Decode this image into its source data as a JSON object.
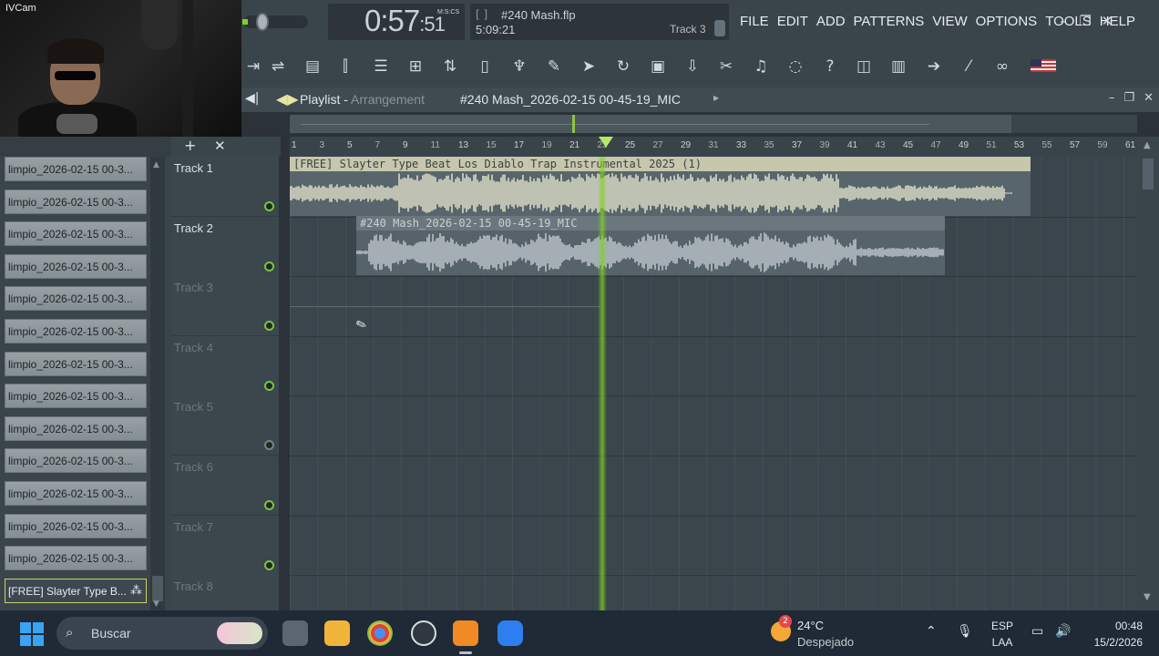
{
  "webcam": {
    "label": "IVCam"
  },
  "transport": {
    "time_main": "0:57",
    "time_sub": ":51",
    "time_format": "M:S:CS"
  },
  "song": {
    "brackets": "[ ]",
    "filename": "#240 Mash.flp",
    "length": "5:09:21",
    "track": "Track 3"
  },
  "menu": [
    "FILE",
    "EDIT",
    "ADD",
    "PATTERNS",
    "VIEW",
    "OPTIONS",
    "TOOLS",
    "HELP"
  ],
  "window_controls": [
    "minimize-icon",
    "restore-icon",
    "close-icon"
  ],
  "toolbar_icons": [
    "tempo-icon",
    "pattern-mode-icon",
    "piano-roll-icon",
    "mixer-icon",
    "channel-rack-icon",
    "step-seq-icon",
    "split-icon",
    "new-file-icon",
    "plugin-icon",
    "brush-icon",
    "pointer-icon",
    "undo-icon",
    "save-icon",
    "render-icon",
    "cut-icon",
    "microphone-icon",
    "chat-icon",
    "help-icon",
    "window-icon",
    "keyboard-icon",
    "arrow-icon",
    "pencil-icon",
    "link-icon",
    "us-flag-icon"
  ],
  "playlist": {
    "title": "Playlist",
    "mode": "Arrangement",
    "pattern": "#240 Mash_2026-02-15 00-45-19_MIC"
  },
  "browser": {
    "items": [
      "limpio_2026-02-15 00-3...",
      "limpio_2026-02-15 00-3...",
      "limpio_2026-02-15 00-3...",
      "limpio_2026-02-15 00-3...",
      "limpio_2026-02-15 00-3...",
      "limpio_2026-02-15 00-3...",
      "limpio_2026-02-15 00-3...",
      "limpio_2026-02-15 00-3...",
      "limpio_2026-02-15 00-3...",
      "limpio_2026-02-15 00-3...",
      "limpio_2026-02-15 00-3...",
      "limpio_2026-02-15 00-3...",
      "limpio_2026-02-15 00-3..."
    ],
    "selected": "[FREE] Slayter Type B..."
  },
  "tracks": [
    {
      "name": "Track 1",
      "enabled": true
    },
    {
      "name": "Track 2",
      "enabled": true
    },
    {
      "name": "Track 3",
      "enabled": true
    },
    {
      "name": "Track 4",
      "enabled": true
    },
    {
      "name": "Track 5",
      "enabled": false
    },
    {
      "name": "Track 6",
      "enabled": true
    },
    {
      "name": "Track 7",
      "enabled": true
    },
    {
      "name": "Track 8",
      "enabled": true
    }
  ],
  "ruler": [
    "1",
    "3",
    "5",
    "7",
    "9",
    "11",
    "13",
    "15",
    "17",
    "19",
    "21",
    "23",
    "25",
    "27",
    "29",
    "31",
    "33",
    "35",
    "37",
    "39",
    "41",
    "43",
    "45",
    "47",
    "49",
    "51",
    "53",
    "55",
    "57",
    "59",
    "61"
  ],
  "clips": [
    {
      "label": "[FREE] Slayter Type Beat Los Diablo  Trap Instrumental 2025 (1)"
    },
    {
      "label": "#240 Mash_2026-02-15 00-45-19_MIC"
    }
  ],
  "playhead": {
    "bar": 23
  },
  "taskbar": {
    "search_placeholder": "Buscar",
    "weather_temp": "24°C",
    "weather_cond": "Despejado",
    "weather_badge": "2",
    "lang_1": "ESP",
    "lang_2": "LAA",
    "time": "00:48",
    "date": "15/2/2026"
  },
  "colors": {
    "accent": "#7ed321",
    "clip1": "#c7c7ae",
    "playhead": "#7ed321"
  }
}
